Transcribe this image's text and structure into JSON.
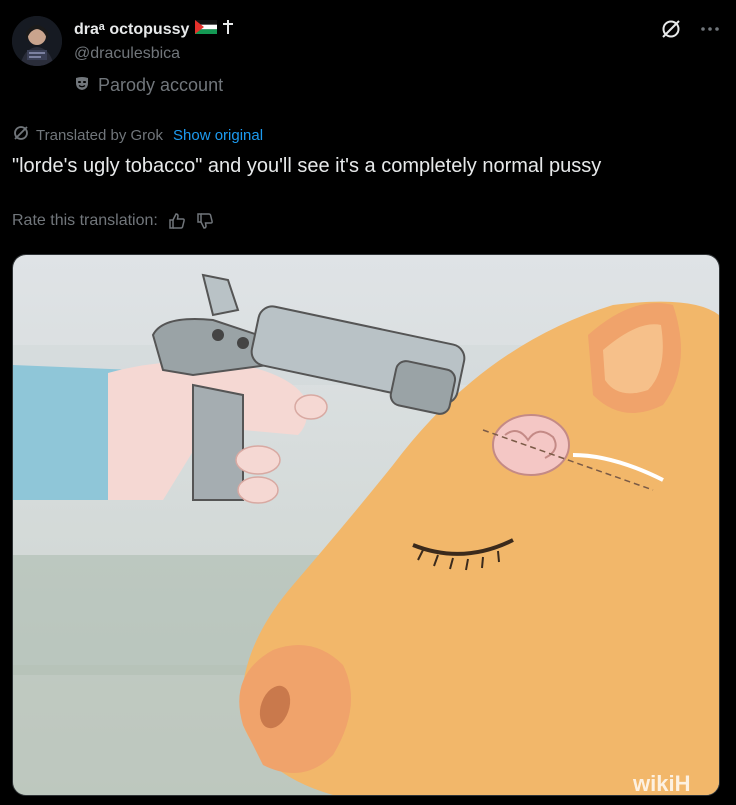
{
  "author": {
    "display_name": "draᵃ octopussy",
    "handle": "@draculesbica",
    "account_label": "Parody account"
  },
  "translation": {
    "translated_by": "Translated by Grok",
    "show_original": "Show original",
    "rate_label": "Rate this translation:"
  },
  "tweet": {
    "text": "\"lorde's ugly tobacco\" and you'll see it's a completely normal pussy"
  },
  "media": {
    "watermark": "wikiH"
  },
  "icons": {
    "grok_icon": "grok-icon",
    "more_icon": "more-icon",
    "parody_mask_icon": "mask-icon",
    "translate_icon": "translate-icon",
    "thumbs_up_icon": "thumbs-up-icon",
    "thumbs_down_icon": "thumbs-down-icon"
  },
  "colors": {
    "background": "#000000",
    "primary_text": "#e7e9ea",
    "secondary_text": "#71767b",
    "link": "#1d9bf0"
  }
}
